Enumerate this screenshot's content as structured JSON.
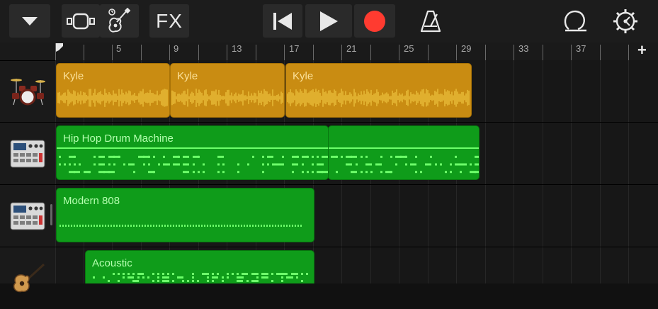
{
  "toolbar": {
    "browser_icon": "chevron-down-icon",
    "tracks_view_icon": "tracks-view-icon",
    "instrument_icon": "guitar-icon",
    "fx_label": "FX",
    "rewind_icon": "skip-back-icon",
    "play_icon": "play-icon",
    "record_icon": "record-icon",
    "metronome_icon": "metronome-icon",
    "loop_icon": "loop-icon",
    "settings_icon": "settings-icon",
    "record_color": "#ff3b30"
  },
  "ruler": {
    "labels": [
      "5",
      "9",
      "13",
      "17",
      "21",
      "25",
      "29",
      "33",
      "37"
    ],
    "add_section_label": "+"
  },
  "tracks": [
    {
      "instrument": "drum kit",
      "icon": "drum-kit-icon"
    },
    {
      "instrument": "drum machine",
      "icon": "drum-machine-icon"
    },
    {
      "instrument": "drum machine",
      "icon": "drum-machine-icon"
    },
    {
      "instrument": "acoustic guitar",
      "icon": "acoustic-guitar-icon"
    }
  ],
  "regions": {
    "kyle_1": "Kyle",
    "kyle_2": "Kyle",
    "kyle_3": "Kyle",
    "hip_hop": "Hip Hop Drum Machine",
    "modern_808": "Modern 808",
    "acoustic": "Acoustic"
  },
  "colors": {
    "audio_region": "#c98c12",
    "midi_region": "#0f9c1a",
    "audio_wave": "#f8d24a",
    "midi_note": "#6dff6a"
  }
}
